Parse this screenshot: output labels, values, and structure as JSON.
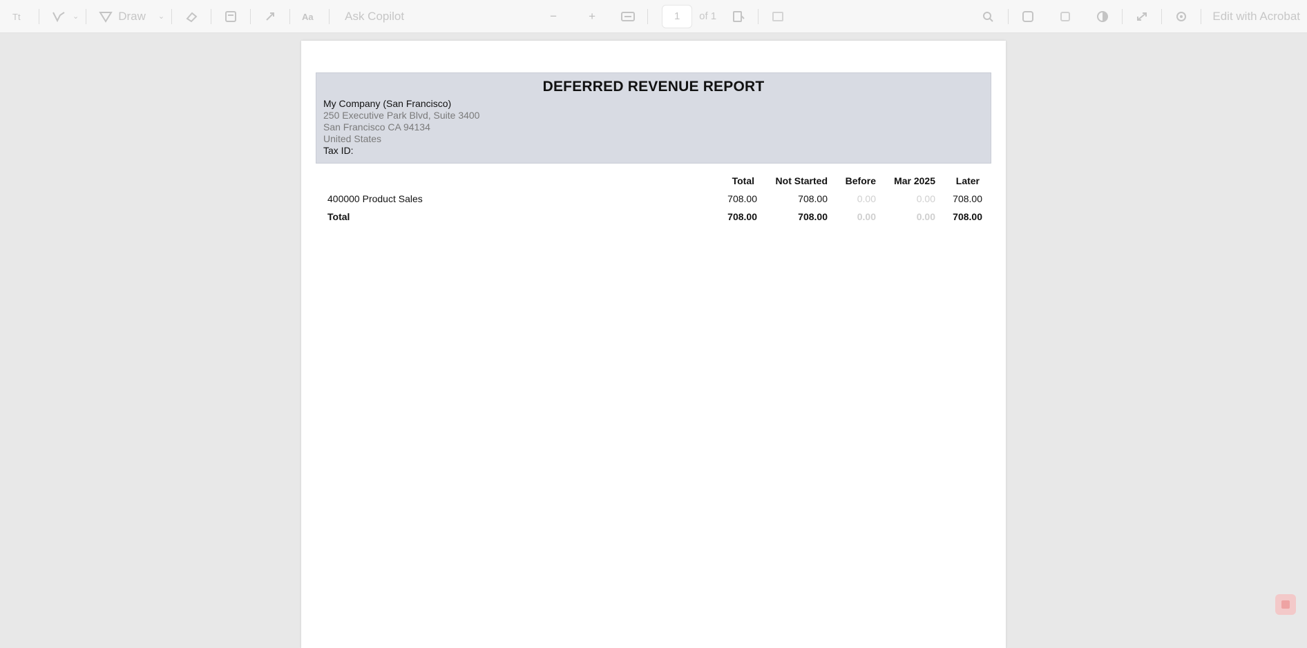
{
  "toolbar": {
    "items": [
      {
        "name": "text-select-tool",
        "glyph": "Ⅰ͟Ⅰ"
      },
      {
        "name": "highlight-tool",
        "glyph": "⋎"
      },
      {
        "name": "draw-tool",
        "glyph": "▽"
      },
      {
        "name": "eraser-tool",
        "glyph": "◈"
      },
      {
        "name": "print-tool",
        "glyph": "▤"
      },
      {
        "name": "rotate-tool",
        "glyph": "↻"
      },
      {
        "name": "read-aloud-tool",
        "glyph": "A"
      }
    ],
    "draw_label": "Draw",
    "ask_copilot_label": "Ask Copilot",
    "zoom_out": "−",
    "zoom_in": "+",
    "page_number": "1",
    "page_count": "of 1",
    "edit_acrobat_label": "Edit with Acrobat"
  },
  "report": {
    "title": "DEFERRED REVENUE REPORT",
    "company_name": "My Company (San Francisco)",
    "address_line1": "250 Executive Park Blvd, Suite 3400",
    "address_line2": "San Francisco CA 94134",
    "address_line3": "United States",
    "tax_id_label": "Tax ID:",
    "columns": {
      "total": "Total",
      "not_started": "Not Started",
      "before": "Before",
      "mar_2025": "Mar 2025",
      "later": "Later"
    },
    "rows": [
      {
        "label": "400000 Product Sales",
        "total": "708.00",
        "not_started": "708.00",
        "before": "0.00",
        "mar_2025": "0.00",
        "later": "708.00"
      }
    ],
    "totals": {
      "label": "Total",
      "total": "708.00",
      "not_started": "708.00",
      "before": "0.00",
      "mar_2025": "0.00",
      "later": "708.00"
    }
  },
  "colors": {
    "header_bg": "#d8dbe3",
    "muted_value": "#cfcfcf",
    "address_text": "#7a7a7a"
  }
}
